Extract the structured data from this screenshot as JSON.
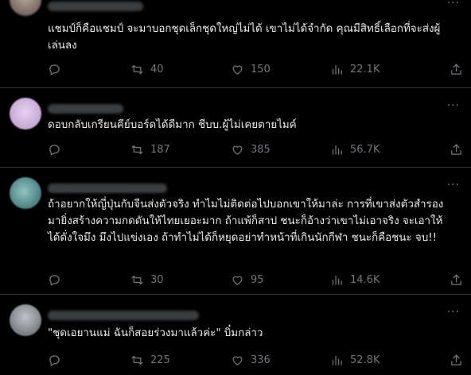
{
  "replies": [
    {
      "text": "แชมป์ก็คือแชมป์ จะมาบอกชุดเล็กชุดใหญ่ไม่ได้ เขาไม่ได้จำกัด คุณมีสิทธิ์เลือกที่จะส่งผู้เล่นลง",
      "reply_count": "",
      "retweets": "40",
      "likes": "150",
      "views": "22.1K"
    },
    {
      "text": "ดอบกลับเกรียนคีย์บอร์ดได้ดีมาก ชีบบ.ผู้ไม่เคยตายไมค์",
      "reply_count": "",
      "retweets": "187",
      "likes": "385",
      "views": "56.7K"
    },
    {
      "text": "ถ้าอยากให้ญี่ปุ่นกับจีนส่งตัวจริง ทำไมไม่ติดต่อไปบอกเขาให้มาล่ะ การที่เขาส่งตัวสำรองมายิ่งสร้างความกดดันให้ไทยเยอะมาก ถ้าแพ้ก็สาป ชนะก็อ้างว่าเขาไม่เอาจริง จะเอาให้ได้ดั่งใจมึง มึงไปแข่งเอง ถ้าทำไม่ได้ก็หยุดอย่าทำหน้าที่เกินนักกีฬา ชนะก็คือชนะ จบ!!",
      "reply_count": "",
      "retweets": "30",
      "likes": "95",
      "views": "14.6K"
    },
    {
      "text": "\"ชุดเอยานแม่ ฉันก็สอยร่วงมาแล้วค่ะ\" บิ๋มกล่าว",
      "reply_count": "",
      "retweets": "225",
      "likes": "336",
      "views": "52.8K"
    }
  ],
  "icons": {
    "reply": "reply-icon",
    "retweet": "retweet-icon",
    "like": "heart-icon",
    "views": "views-icon",
    "share": "share-icon",
    "more": "more-icon"
  },
  "colors": {
    "background": "#000000",
    "text": "#e7e9ea",
    "muted": "#71767b",
    "divider": "#2f3336"
  }
}
